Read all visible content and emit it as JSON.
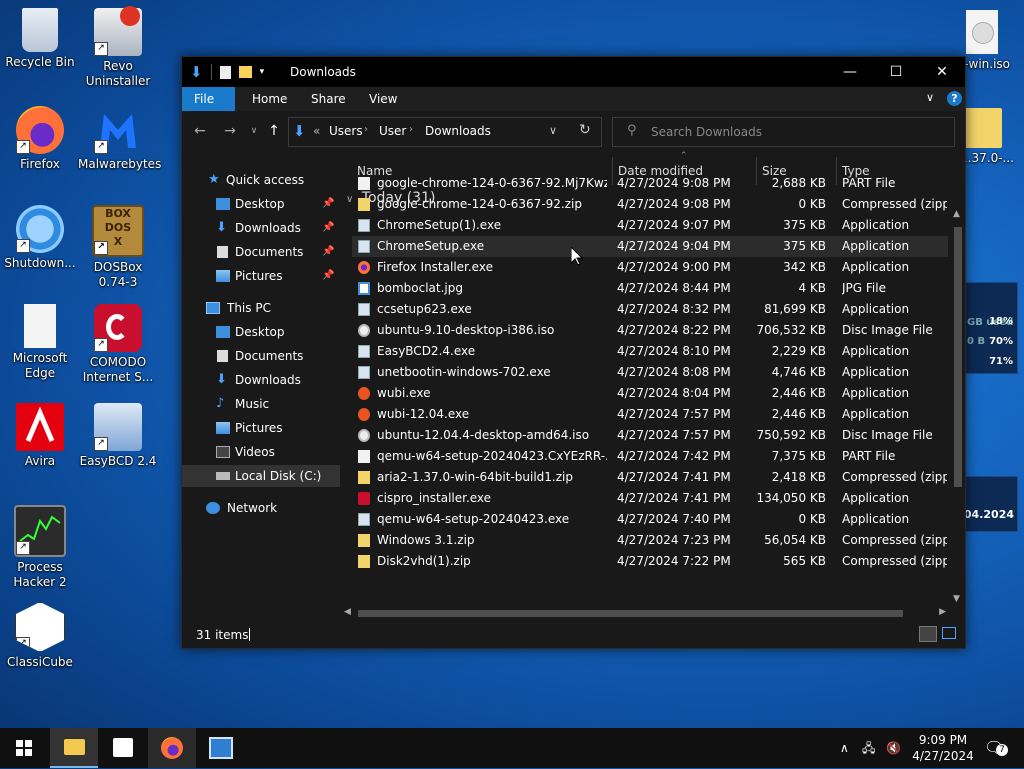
{
  "desktop": {
    "icons": [
      {
        "label": "Recycle Bin"
      },
      {
        "label": "Revo Uninstaller"
      },
      {
        "label": "Firefox"
      },
      {
        "label": "Malwarebytes"
      },
      {
        "label": "Shutdown..."
      },
      {
        "label": "DOSBox 0.74-3"
      },
      {
        "label": "Microsoft Edge"
      },
      {
        "label": "COMODO Internet S..."
      },
      {
        "label": "Avira"
      },
      {
        "label": "EasyBCD 2.4"
      },
      {
        "label": "Process Hacker 2"
      },
      {
        "label": "ClassiCube"
      },
      {
        "label": "-win.iso"
      },
      {
        "label": "-1.37.0-..."
      }
    ],
    "widget": {
      "line1": "GB used",
      "val1": "18%",
      "line2": "0 B",
      "val2": "70%",
      "val3": "71%"
    },
    "widget2": {
      "date": ".04.2024"
    }
  },
  "window": {
    "title": "Downloads",
    "ribbon_tabs": [
      "File",
      "Home",
      "Share",
      "View"
    ],
    "address": {
      "sep": "«",
      "crumbs": [
        "Users",
        "User",
        "Downloads"
      ]
    },
    "search_placeholder": "Search Downloads",
    "nav": {
      "quick_access": "Quick access",
      "qa_items": [
        "Desktop",
        "Downloads",
        "Documents",
        "Pictures"
      ],
      "this_pc": "This PC",
      "pc_items": [
        "Desktop",
        "Documents",
        "Downloads",
        "Music",
        "Pictures",
        "Videos",
        "Local Disk (C:)"
      ],
      "network": "Network"
    },
    "columns": {
      "name": "Name",
      "date": "Date modified",
      "size": "Size",
      "type": "Type"
    },
    "group": "Today (31)",
    "files": [
      {
        "name": "google-chrome-124-0-6367-92.Mj7KwzO...",
        "date": "4/27/2024 9:08 PM",
        "size": "2,688 KB",
        "type": "PART File",
        "kind": "blank"
      },
      {
        "name": "google-chrome-124-0-6367-92.zip",
        "date": "4/27/2024 9:08 PM",
        "size": "0 KB",
        "type": "Compressed (zipp...",
        "kind": "zip"
      },
      {
        "name": "ChromeSetup(1).exe",
        "date": "4/27/2024 9:07 PM",
        "size": "375 KB",
        "type": "Application",
        "kind": "app"
      },
      {
        "name": "ChromeSetup.exe",
        "date": "4/27/2024 9:04 PM",
        "size": "375 KB",
        "type": "Application",
        "kind": "app"
      },
      {
        "name": "Firefox Installer.exe",
        "date": "4/27/2024 9:00 PM",
        "size": "342 KB",
        "type": "Application",
        "kind": "firefox"
      },
      {
        "name": "bomboclat.jpg",
        "date": "4/27/2024 8:44 PM",
        "size": "4 KB",
        "type": "JPG File",
        "kind": "img"
      },
      {
        "name": "ccsetup623.exe",
        "date": "4/27/2024 8:32 PM",
        "size": "81,699 KB",
        "type": "Application",
        "kind": "app"
      },
      {
        "name": "ubuntu-9.10-desktop-i386.iso",
        "date": "4/27/2024 8:22 PM",
        "size": "706,532 KB",
        "type": "Disc Image File",
        "kind": "disc"
      },
      {
        "name": "EasyBCD2.4.exe",
        "date": "4/27/2024 8:10 PM",
        "size": "2,229 KB",
        "type": "Application",
        "kind": "app"
      },
      {
        "name": "unetbootin-windows-702.exe",
        "date": "4/27/2024 8:08 PM",
        "size": "4,746 KB",
        "type": "Application",
        "kind": "app"
      },
      {
        "name": "wubi.exe",
        "date": "4/27/2024 8:04 PM",
        "size": "2,446 KB",
        "type": "Application",
        "kind": "ubuntu"
      },
      {
        "name": "wubi-12.04.exe",
        "date": "4/27/2024 7:57 PM",
        "size": "2,446 KB",
        "type": "Application",
        "kind": "ubuntu"
      },
      {
        "name": "ubuntu-12.04.4-desktop-amd64.iso",
        "date": "4/27/2024 7:57 PM",
        "size": "750,592 KB",
        "type": "Disc Image File",
        "kind": "disc"
      },
      {
        "name": "qemu-w64-setup-20240423.CxYEzRR-.ex...",
        "date": "4/27/2024 7:42 PM",
        "size": "7,375 KB",
        "type": "PART File",
        "kind": "blank"
      },
      {
        "name": "aria2-1.37.0-win-64bit-build1.zip",
        "date": "4/27/2024 7:41 PM",
        "size": "2,418 KB",
        "type": "Compressed (zipp...",
        "kind": "zip"
      },
      {
        "name": "cispro_installer.exe",
        "date": "4/27/2024 7:41 PM",
        "size": "134,050 KB",
        "type": "Application",
        "kind": "comodo"
      },
      {
        "name": "qemu-w64-setup-20240423.exe",
        "date": "4/27/2024 7:40 PM",
        "size": "0 KB",
        "type": "Application",
        "kind": "app"
      },
      {
        "name": "Windows 3.1.zip",
        "date": "4/27/2024 7:23 PM",
        "size": "56,054 KB",
        "type": "Compressed (zipp...",
        "kind": "zip"
      },
      {
        "name": "Disk2vhd(1).zip",
        "date": "4/27/2024 7:22 PM",
        "size": "565 KB",
        "type": "Compressed (zipp...",
        "kind": "zip"
      }
    ],
    "status": "31 items"
  },
  "taskbar": {
    "time": "9:09 PM",
    "date": "4/27/2024",
    "notifications": "7"
  }
}
